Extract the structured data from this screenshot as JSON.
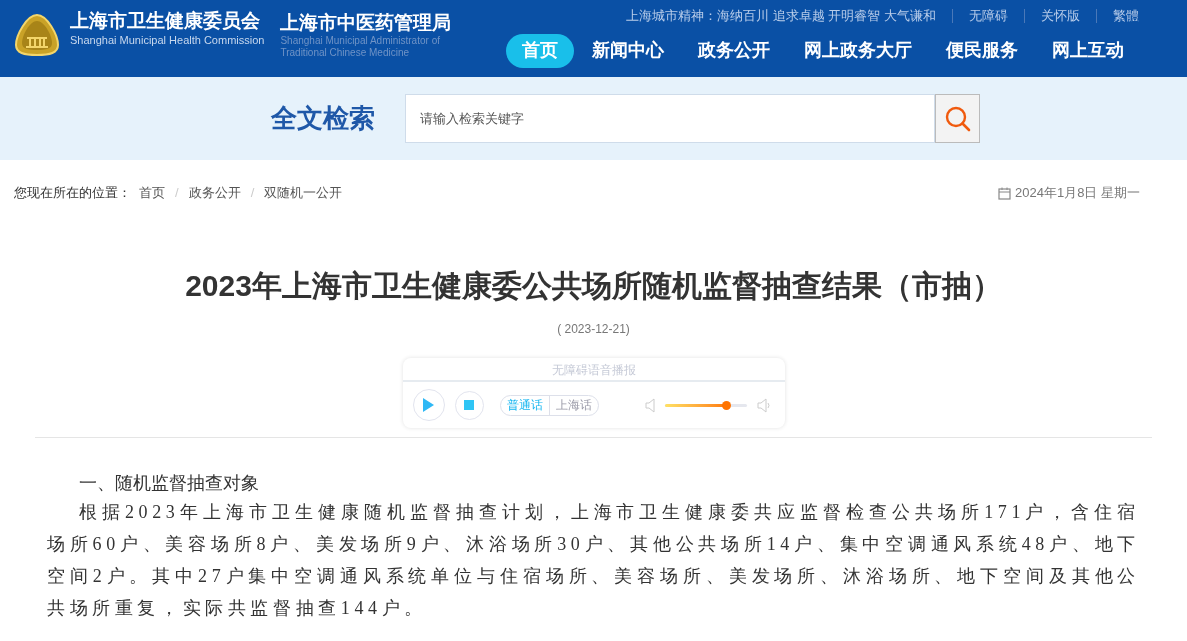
{
  "header": {
    "title_cn": "上海市卫生健康委员会",
    "title_en": "Shanghai Municipal Health Commission",
    "title2_cn": "上海市中医药管理局",
    "title2_en_lines": [
      "Shanghai Municipal Administrator of",
      "Traditional Chinese Medicine"
    ],
    "motto": "上海城市精神：海纳百川 追求卓越 开明睿智 大气谦和",
    "top_links": [
      "无障碍",
      "关怀版",
      "繁體"
    ],
    "nav": [
      {
        "label": "首页",
        "selected": true
      },
      {
        "label": "新闻中心",
        "selected": false
      },
      {
        "label": "政务公开",
        "selected": false
      },
      {
        "label": "网上政务大厅",
        "selected": false
      },
      {
        "label": "便民服务",
        "selected": false
      },
      {
        "label": "网上互动",
        "selected": false
      }
    ]
  },
  "search": {
    "label": "全文检索",
    "placeholder": "请输入检索关键字"
  },
  "breadcrumb": {
    "prefix": "您现在所在的位置：",
    "separator": "/",
    "items": [
      "首页",
      "政务公开",
      "双随机一公开"
    ]
  },
  "date": "2024年1月8日 星期一",
  "article": {
    "title": "2023年上海市卫生健康委公共场所随机监督抽查结果（市抽）",
    "date": "( 2023-12-21)",
    "player": {
      "title": "无障碍语音播报",
      "languages": [
        {
          "label": "普通话",
          "selected": true
        },
        {
          "label": "上海话",
          "selected": false
        }
      ],
      "volume": {
        "level": 0.76
      }
    },
    "heading": "一、随机监督抽查对象",
    "paragraph": "根据2023年上海市卫生健康随机监督抽查计划，上海市卫生健康委共应监督检查公共场所171户，含住宿场所60户、美容场所8户、美发场所9户、沐浴场所30户、其他公共场所14户、集中空调通风系统48户、地下空间2户。其中27户集中空调通风系统单位与住宿场所、美容场所、美发场所、沐浴场所、地下空间及其他公共场所重复，实际共监督抽查144户。"
  }
}
